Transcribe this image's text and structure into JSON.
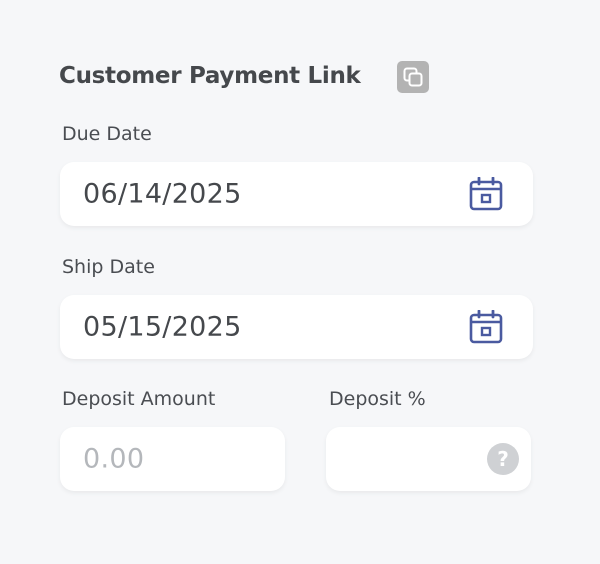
{
  "form": {
    "title": "Customer Payment Link",
    "due_date": {
      "label": "Due Date",
      "value": "06/14/2025"
    },
    "ship_date": {
      "label": "Ship Date",
      "value": "05/15/2025"
    },
    "deposit_amount": {
      "label": "Deposit Amount",
      "placeholder": "0.00"
    },
    "deposit_percent": {
      "label": "Deposit %",
      "value": "",
      "help_glyph": "?"
    }
  },
  "icons": {
    "copy": "copy-icon",
    "calendar": "calendar-icon",
    "help": "help-icon"
  },
  "colors": {
    "background": "#f6f7f9",
    "field": "#ffffff",
    "calendar_icon": "#4a5aa0",
    "copy_button": "#b3b3b3",
    "help_icon": "#cfd1d4"
  }
}
